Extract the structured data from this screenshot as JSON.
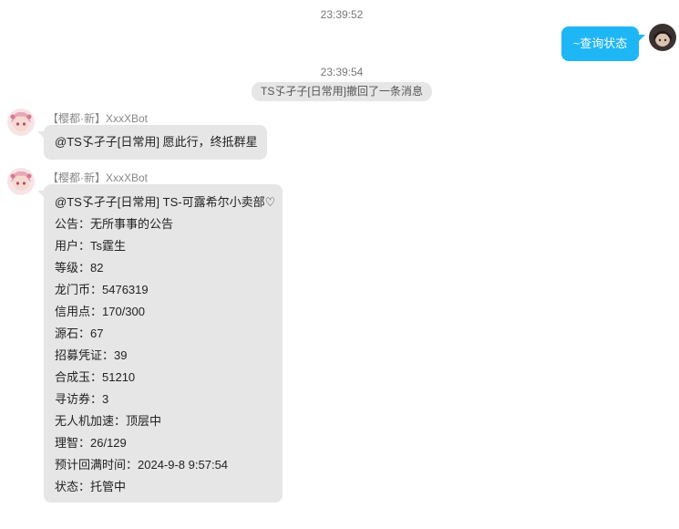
{
  "messages": {
    "time1": "23:39:52",
    "outgoing": {
      "text": "~查询状态"
    },
    "time2": "23:39:54",
    "recall_notice": "TS孓孑子[日常用]撤回了一条消息",
    "msg1": {
      "sender_tag": "【樱都·新】",
      "sender_name": "XxxXBot",
      "text": "@TS孓孑子[日常用] 愿此行，终抵群星"
    },
    "msg2": {
      "sender_tag": "【樱都·新】",
      "sender_name": "XxxXBot",
      "lines": [
        "@TS孓孑子[日常用] TS-可露希尔小卖部♡",
        "公告：无所事事的公告",
        "用户：Ts霆生",
        "等级：82",
        "龙门币：5476319",
        "信用点：170/300",
        "源石：67",
        "招募凭证：39",
        "合成玉：51210",
        "寻访券：3",
        "无人机加速：顶层中",
        "理智：26/129",
        "预计回满时间：2024-9-8 9:57:54",
        "状态：托管中"
      ]
    }
  },
  "colors": {
    "outgoing_bubble": "#1fb6f5",
    "incoming_bubble": "#e6e6e6"
  }
}
